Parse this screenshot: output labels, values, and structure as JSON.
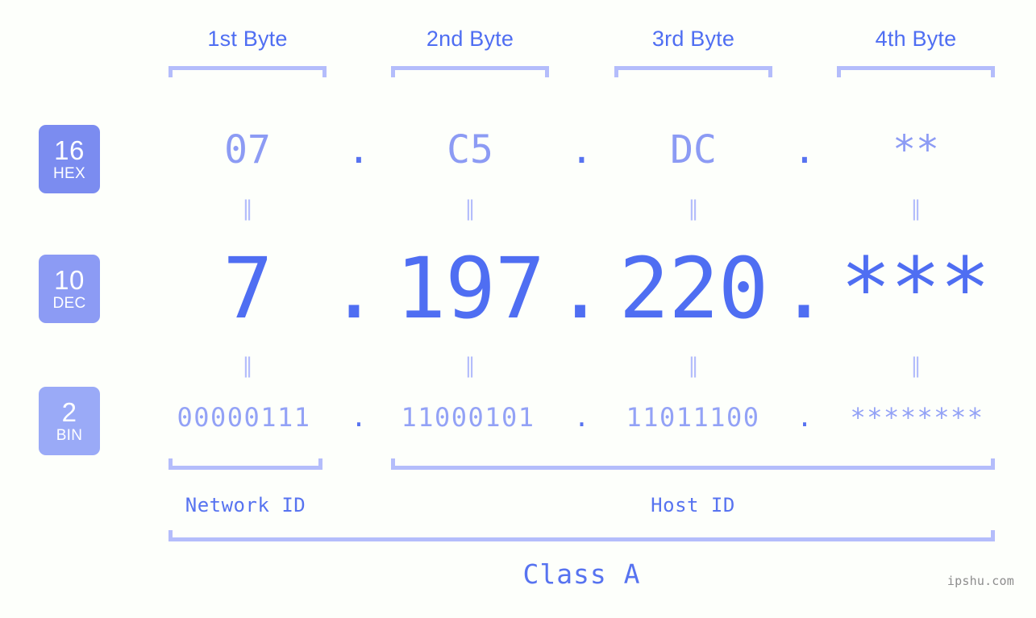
{
  "colors": {
    "background": "#fdfffb",
    "accent_strong": "#4f6ef2",
    "accent_mid": "#5773f0",
    "accent_light": "#8c9bf4",
    "accent_pale": "#b4bdfb",
    "badge_hex": "#7b8cf0",
    "badge_dec": "#8c9bf4",
    "badge_bin": "#9aaaf7",
    "watermark": "#8d8d8d"
  },
  "header": {
    "byte_labels": [
      "1st Byte",
      "2nd Byte",
      "3rd Byte",
      "4th Byte"
    ]
  },
  "bases": [
    {
      "number": "16",
      "name": "HEX"
    },
    {
      "number": "10",
      "name": "DEC"
    },
    {
      "number": "2",
      "name": "BIN"
    }
  ],
  "rows": {
    "hex": {
      "values": [
        "07",
        "C5",
        "DC",
        "**"
      ],
      "separators": [
        ".",
        ".",
        "."
      ]
    },
    "dec": {
      "values": [
        "7",
        "197",
        "220",
        "***"
      ],
      "separators": [
        ".",
        ".",
        "."
      ]
    },
    "bin": {
      "values": [
        "00000111",
        "11000101",
        "11011100",
        "********"
      ],
      "separators": [
        ".",
        ".",
        "."
      ]
    }
  },
  "equality_marks": {
    "glyph": "‖",
    "count_per_gap": 4
  },
  "footer": {
    "network_id_label": "Network ID",
    "host_id_label": "Host ID",
    "class_label": "Class A",
    "watermark": "ipshu.com"
  }
}
